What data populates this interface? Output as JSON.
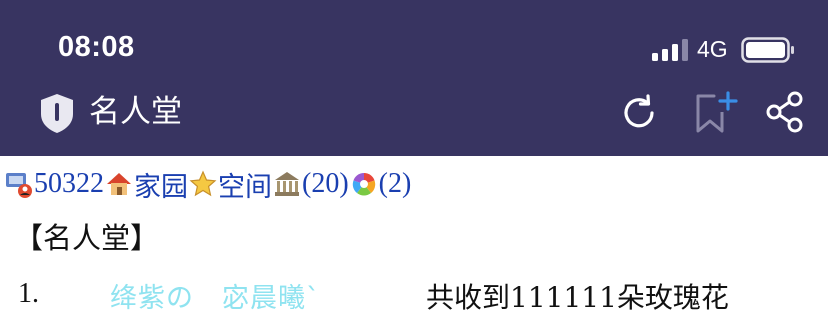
{
  "status_bar": {
    "time": "08:08",
    "network": "4G"
  },
  "nav_bar": {
    "title": "名人堂",
    "icons": [
      "shield-icon",
      "reload-icon",
      "bookmark-add-icon",
      "share-icon"
    ],
    "colors": {
      "background": "#383461",
      "foreground": "#ffffff",
      "accent": "#3a8ee6"
    }
  },
  "links": {
    "mail_count": "50322",
    "home_label": "家园",
    "space_label": "空间",
    "museum_count": "(20)",
    "album_count": "(2)"
  },
  "page": {
    "heading": "【名人堂】"
  },
  "rankings": [
    {
      "rank": "1.",
      "name": "绛紫の　宓晨曦ˋ",
      "desc": "共收到111111朵玫瑰花",
      "name_color": "#8fe3f0"
    }
  ]
}
